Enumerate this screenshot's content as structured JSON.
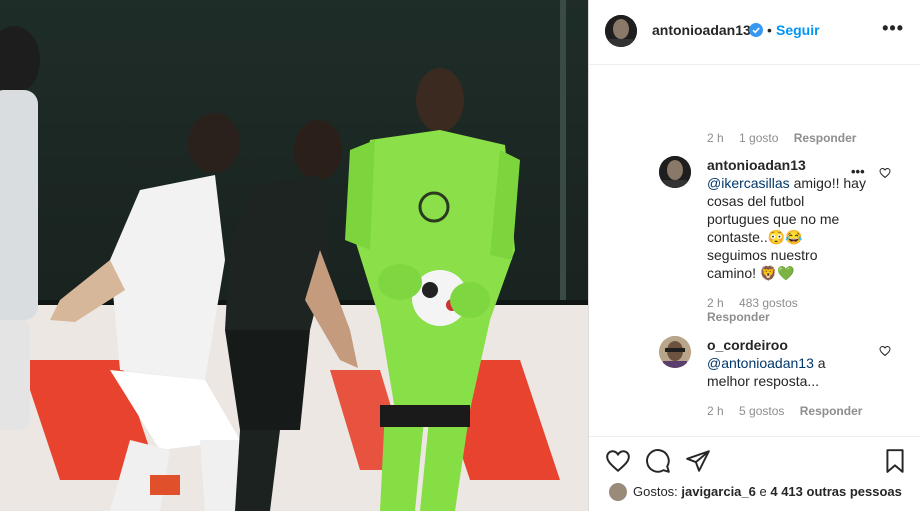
{
  "post": {
    "username": "antonioadan13",
    "follow_label": "Seguir",
    "dot": "•",
    "more_label": "•••"
  },
  "top_meta": {
    "time": "2 h",
    "likes": "1 gosto",
    "reply": "Responder"
  },
  "comments": [
    {
      "username": "antonioadan13",
      "mention": "@ikercasillas",
      "text_lines": [
        "amigo!! hay",
        "cosas del futbol",
        "portugues que no me",
        "contaste..😳😂",
        "seguimos nuestro",
        "camino! 🦁💚"
      ],
      "time": "2 h",
      "likes": "483 gostos",
      "reply": "Responder"
    },
    {
      "username": "o_cordeiroo",
      "mention": "@antonioadan13",
      "text_lines": [
        "a",
        "melhor resposta..."
      ],
      "time": "2 h",
      "likes": "5 gostos",
      "reply": "Responder"
    }
  ],
  "likes_bar": {
    "prefix": "Gostos:",
    "user": "javigarcia_6",
    "middle": "e",
    "others": "4 413 outras pessoas"
  },
  "colors": {
    "link": "#0095f6",
    "mention": "#00376b",
    "verified": "#3897f0",
    "jersey_green": "#8be04a"
  }
}
